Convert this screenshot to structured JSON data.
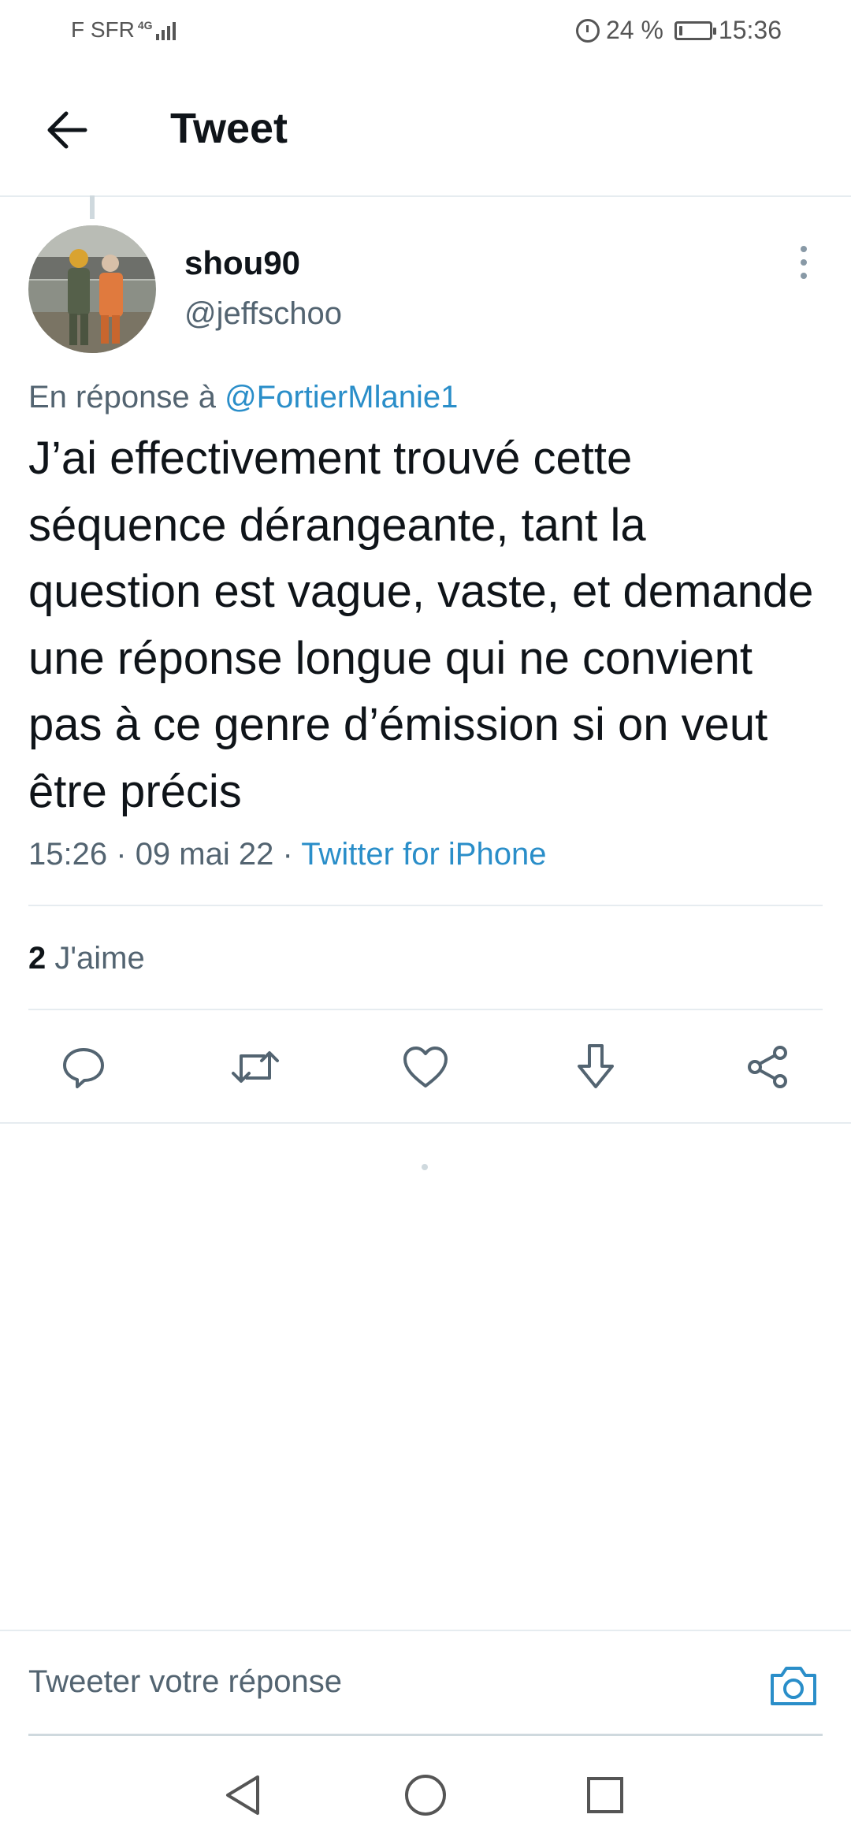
{
  "status_bar": {
    "carrier": "F SFR",
    "network": "4G",
    "battery_percent": "24 %",
    "battery_level": 0.24,
    "time": "15:36"
  },
  "header": {
    "title": "Tweet",
    "back_icon": "arrow-left-icon"
  },
  "tweet": {
    "author_name": "shou90",
    "author_handle": "@jeffschoo",
    "reply_prefix": "En réponse à",
    "reply_to": "@FortierMlanie1",
    "text": "J’ai effectivement trouvé cette séquence dérangeante, tant la question est vague, vaste, et demande une réponse longue qui ne convient pas à ce genre d’émission si on veut être précis",
    "time": "15:26",
    "date": "09 mai 22",
    "separator": "·",
    "source": "Twitter for iPhone",
    "likes_count": "2",
    "likes_label": "J'aime"
  },
  "actions": [
    {
      "icon": "reply-icon"
    },
    {
      "icon": "retweet-icon"
    },
    {
      "icon": "like-heart-icon"
    },
    {
      "icon": "bookmark-download-icon"
    },
    {
      "icon": "share-icon"
    }
  ],
  "composer": {
    "placeholder": "Tweeter votre réponse",
    "camera_icon": "camera-icon"
  },
  "colors": {
    "link": "#2a8ec9",
    "text": "#0f1419",
    "secondary_text": "#536471",
    "divider": "#e6ecf0"
  }
}
